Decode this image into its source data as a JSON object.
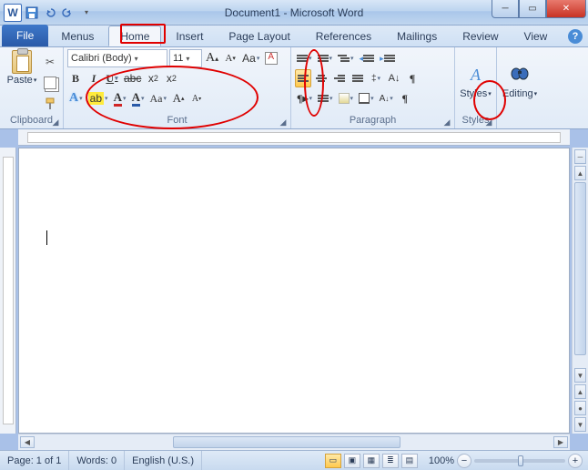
{
  "title": "Document1 - Microsoft Word",
  "qat": {
    "word": "W"
  },
  "tabs": {
    "file": "File",
    "items": [
      "Menus",
      "Home",
      "Insert",
      "Page Layout",
      "References",
      "Mailings",
      "Review",
      "View"
    ],
    "active_index": 1
  },
  "clipboard": {
    "label": "Clipboard",
    "paste": "Paste"
  },
  "font": {
    "label": "Font",
    "name": "Calibri (Body)",
    "size": "11",
    "grow": "A",
    "shrink": "A",
    "case": "Aa",
    "bold": "B",
    "italic": "I",
    "underline": "U",
    "strike": "abc",
    "subscript": "x",
    "subscript_s": "2",
    "superscript": "x",
    "superscript_s": "2",
    "texteffects": "A",
    "highlight": "ab",
    "color": "A",
    "clear": "A",
    "incFont": "A",
    "decFont": "A"
  },
  "paragraph": {
    "label": "Paragraph",
    "pilcrow": "¶",
    "sort": "A↓Z"
  },
  "styles": {
    "label": "Styles",
    "heading": "Styles",
    "icon": "A"
  },
  "editing": {
    "label": "Editing",
    "heading": "Editing"
  },
  "status": {
    "page": "Page: 1 of 1",
    "words": "Words: 0",
    "lang": "English (U.S.)",
    "zoom": "100%"
  }
}
